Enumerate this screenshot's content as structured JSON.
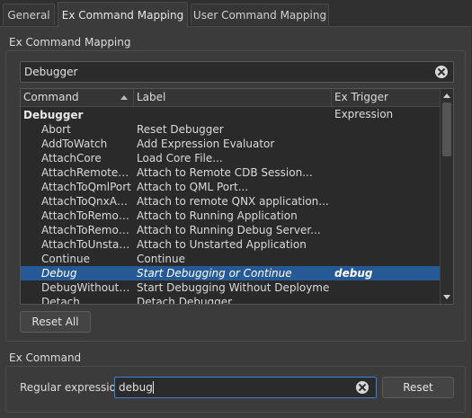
{
  "tabs": [
    {
      "label": "General",
      "active": false
    },
    {
      "label": "Ex Command Mapping",
      "active": true
    },
    {
      "label": "User Command Mapping",
      "active": false
    }
  ],
  "mapping_group": {
    "title": "Ex Command Mapping",
    "filter_value": "Debugger",
    "columns": [
      "Command",
      "Label",
      "Ex Trigger Expression"
    ],
    "rows": [
      {
        "type": "group",
        "command": "Debugger",
        "label": "",
        "trigger": ""
      },
      {
        "type": "item",
        "command": "Abort",
        "label": "Reset Debugger",
        "trigger": ""
      },
      {
        "type": "item",
        "command": "AddToWatch",
        "label": "Add Expression Evaluator",
        "trigger": ""
      },
      {
        "type": "item",
        "command": "AttachCore",
        "label": "Load Core File...",
        "trigger": ""
      },
      {
        "type": "item",
        "command": "AttachRemoteCdb",
        "label": "Attach to Remote CDB Session...",
        "trigger": ""
      },
      {
        "type": "item",
        "command": "AttachToQmlPort",
        "label": "Attach to QML Port...",
        "trigger": ""
      },
      {
        "type": "item",
        "command": "AttachToQnxAp...",
        "label": "Attach to remote QNX application...",
        "trigger": ""
      },
      {
        "type": "item",
        "command": "AttachToRemote...",
        "label": "Attach to Running Application",
        "trigger": ""
      },
      {
        "type": "item",
        "command": "AttachToRemote...",
        "label": "Attach to Running Debug Server...",
        "trigger": ""
      },
      {
        "type": "item",
        "command": "AttachToUnstart...",
        "label": "Attach to Unstarted Application",
        "trigger": ""
      },
      {
        "type": "item",
        "command": "Continue",
        "label": "Continue",
        "trigger": ""
      },
      {
        "type": "item",
        "command": "Debug",
        "label": "Start Debugging or Continue",
        "trigger": "debug",
        "selected": true
      },
      {
        "type": "item",
        "command": "DebugWithoutD...",
        "label": "Start Debugging Without Deployment",
        "trigger": ""
      },
      {
        "type": "item",
        "command": "Detach",
        "label": "Detach Debugger",
        "trigger": ""
      }
    ],
    "reset_all_label": "Reset All"
  },
  "ex_command_group": {
    "title": "Ex Command",
    "regex_label": "Regular expression:",
    "regex_value": "debug",
    "reset_label": "Reset"
  },
  "colors": {
    "background": "#303030",
    "panel": "#3b3b3b",
    "selection": "#265a96",
    "focus_border": "#3d82d6"
  }
}
